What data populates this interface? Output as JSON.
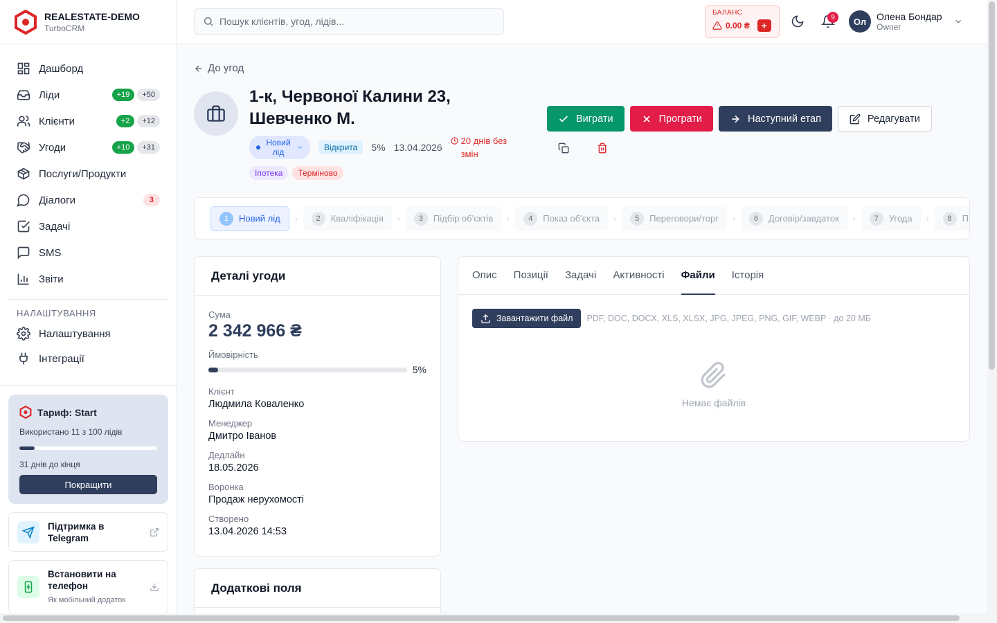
{
  "app": {
    "name": "REALESTATE-DEMO",
    "subtitle": "TurboCRM"
  },
  "sidebar": {
    "items": [
      {
        "label": "Дашборд"
      },
      {
        "label": "Ліди",
        "badge_new": "+19",
        "badge_total": "+50"
      },
      {
        "label": "Клієнти",
        "badge_new": "+2",
        "badge_total": "+12"
      },
      {
        "label": "Угоди",
        "badge_new": "+10",
        "badge_total": "+31"
      },
      {
        "label": "Послуги/Продукти"
      },
      {
        "label": "Діалоги",
        "badge_alert": "3"
      },
      {
        "label": "Задачі"
      },
      {
        "label": "SMS"
      },
      {
        "label": "Звіти"
      }
    ],
    "section_title": "НАЛАШТУВАННЯ",
    "settings_items": [
      {
        "label": "Налаштування"
      },
      {
        "label": "Інтеграції"
      }
    ],
    "tariff": {
      "title": "Тариф: Start",
      "used": "Використано 11 з 100 лідів",
      "used_fraction": 0.11,
      "days_left": "31 днів до кінця",
      "upgrade_label": "Покращити"
    },
    "support": {
      "title": "Підтримка в Telegram"
    },
    "install": {
      "title": "Встановити на телефон",
      "subtitle": "Як мобільний додаток"
    }
  },
  "topbar": {
    "search_placeholder": "Пошук клієнтів, угод, лідів...",
    "balance_label": "БАЛАНС",
    "balance_value": "0.00 ₴",
    "balance_add": "+",
    "notifications_count": "9",
    "user_initials": "Ол",
    "user_name": "Олена Бондар",
    "user_role": "Owner"
  },
  "deal": {
    "back_label": "До угод",
    "title": "1-к, Червоної Калини 23, Шевченко М.",
    "stage_pill": "Новий лід",
    "status": "Відкрита",
    "probability": "5%",
    "date": "13.04.2026",
    "stale_warning": "20 днів без змін",
    "tags": [
      "Іпотека",
      "Терміново"
    ],
    "actions": {
      "win": "Виграти",
      "lose": "Програти",
      "next": "Наступний етап",
      "edit": "Редагувати"
    }
  },
  "pipeline": [
    {
      "num": "1",
      "label": "Новий лід",
      "active": true
    },
    {
      "num": "2",
      "label": "Кваліфікація"
    },
    {
      "num": "3",
      "label": "Підбір об'єктів"
    },
    {
      "num": "4",
      "label": "Показ об'єкта"
    },
    {
      "num": "5",
      "label": "Переговори/торг"
    },
    {
      "num": "6",
      "label": "Договір/завдаток"
    },
    {
      "num": "7",
      "label": "Угода"
    },
    {
      "num": "8",
      "label": "Прогр"
    }
  ],
  "details": {
    "title": "Деталі угоди",
    "sum_label": "Сума",
    "sum_value": "2 342 966 ₴",
    "probability_label": "Ймовірність",
    "probability_value": "5%",
    "probability_fraction": 0.05,
    "client_label": "Клієнт",
    "client_value": "Людмила Коваленко",
    "manager_label": "Менеджер",
    "manager_value": "Дмитро Іванов",
    "deadline_label": "Дедлайн",
    "deadline_value": "18.05.2026",
    "funnel_label": "Воронка",
    "funnel_value": "Продаж нерухомості",
    "created_label": "Створено",
    "created_value": "13.04.2026 14:53"
  },
  "extra": {
    "title": "Додаткові поля"
  },
  "files_panel": {
    "tabs": [
      "Опис",
      "Позиції",
      "Задачі",
      "Активності",
      "Файли",
      "Історія"
    ],
    "active_tab": "Файли",
    "upload_label": "Завантажити файл",
    "formats": "PDF, DOC, DOCX, XLS, XLSX, JPG, JPEG, PNG, GIF, WEBP · до 20 МБ",
    "empty_text": "Немає файлів"
  }
}
